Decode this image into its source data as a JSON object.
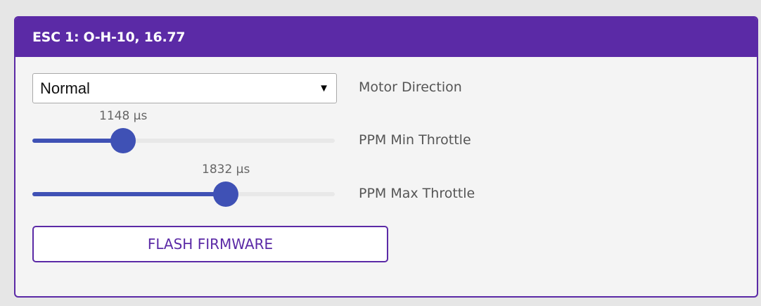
{
  "esc": {
    "title": "ESC 1: O-H-10, 16.77"
  },
  "motor_direction": {
    "selected": "Normal",
    "label": "Motor Direction"
  },
  "ppm_min": {
    "value_text": "1148 µs",
    "label": "PPM Min Throttle",
    "level": 0.3
  },
  "ppm_max": {
    "value_text": "1832 µs",
    "label": "PPM Max Throttle",
    "level": 0.64
  },
  "actions": {
    "flash_label": "FLASH FIRMWARE"
  },
  "colors": {
    "accent": "#5b2aa6",
    "slider": "#3f51b5"
  }
}
